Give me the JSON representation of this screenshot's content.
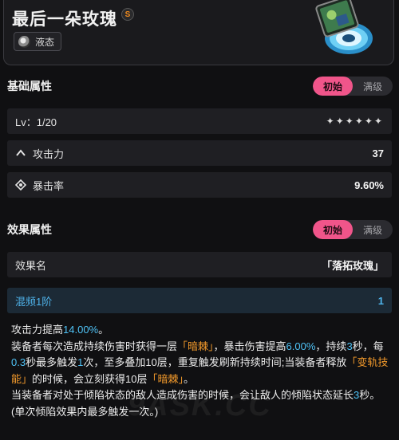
{
  "header": {
    "title": "最后一朵玫瑰",
    "rank": "S",
    "attribute": "液态"
  },
  "basic": {
    "title": "基础属性",
    "tabs": [
      "初始",
      "满级"
    ],
    "active_tab": "初始",
    "level": "Lv：1/20",
    "stars": "✦✦✦✦✦✦",
    "stats": [
      {
        "label": "攻击力",
        "value": "37",
        "icon": "attack-icon"
      },
      {
        "label": "暴击率",
        "value": "9.60%",
        "icon": "crit-rate-icon"
      }
    ]
  },
  "effect": {
    "title": "效果属性",
    "tabs": [
      "初始",
      "满级"
    ],
    "active_tab": "初始",
    "name_label": "效果名",
    "name_value": "「落拓玫瑰」",
    "tier_label": "混频1阶",
    "tier_value": "1",
    "description": {
      "p1_a": "攻击力提高",
      "p1_b": "14.00%",
      "p1_c": "。",
      "p2_a": "装备者每次造成持续伤害时获得一层",
      "p2_b": "「暗棘」",
      "p2_c": "，暴击伤害提高",
      "p2_d": "6.00%",
      "p2_e": "，持续",
      "p2_f": "3",
      "p2_g": "秒，每",
      "p2_h": "0.3",
      "p2_i": "秒最多触发",
      "p2_j": "1",
      "p2_k": "次，至多叠加10层，重复触发刷新持续时间;当装备者释放",
      "p2_l": "「变轨技能」",
      "p2_m": "的时候，会立刻获得10层",
      "p2_n": "「暗棘」",
      "p2_o": "。",
      "p3_a": "当装备者对处于倾陷状态的敌人造成伤害的时候，会让敌人的倾陷状态延长",
      "p3_b": "3",
      "p3_c": "秒。(单次倾陷效果内最多触发一次。)"
    }
  },
  "watermark": "9ASK.CC",
  "colors": {
    "accent": "#f0558a",
    "highlight": "#4fc3f7",
    "keyword": "#f39a2b",
    "tier": "#4fb4ec"
  }
}
